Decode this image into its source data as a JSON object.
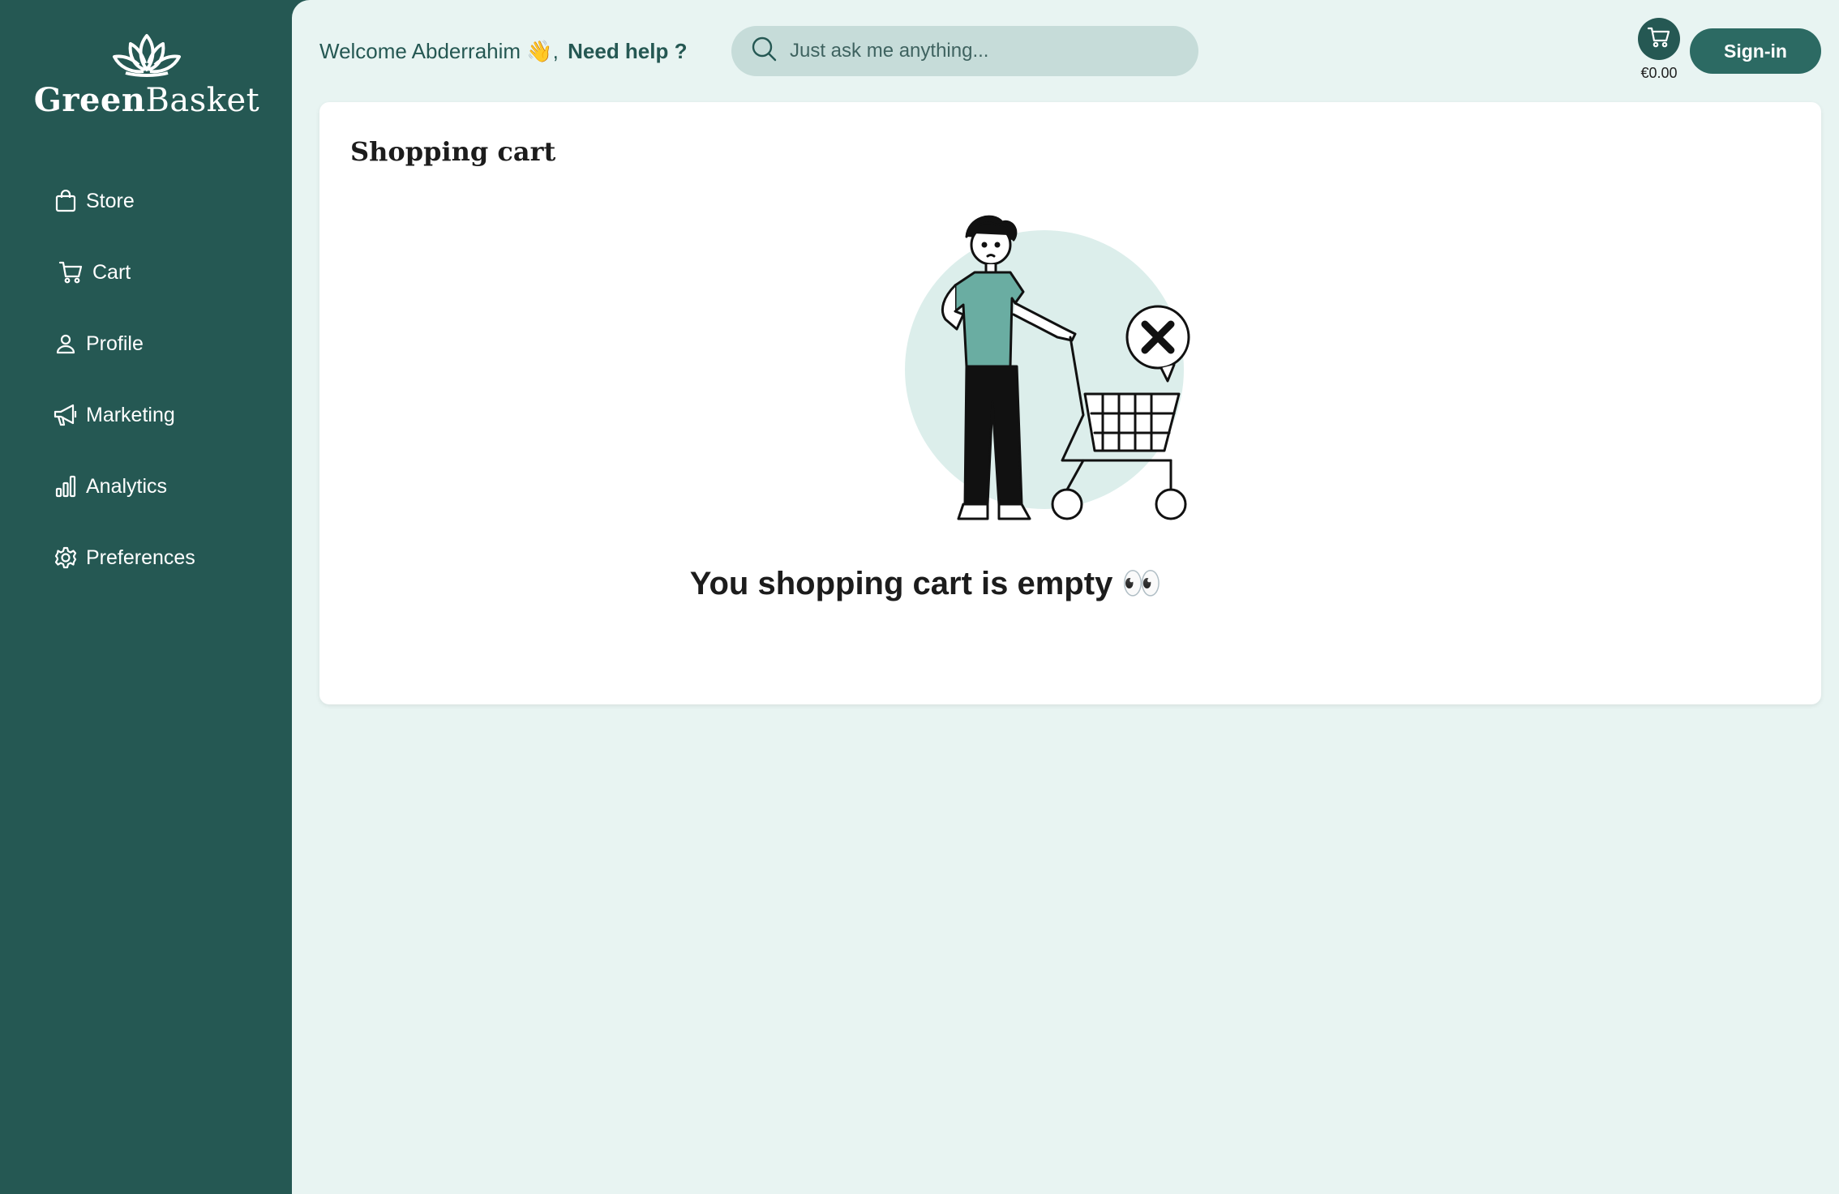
{
  "brand": {
    "name_bold": "Green",
    "name_light": "Basket"
  },
  "sidebar": {
    "items": [
      {
        "label": "Store",
        "icon": "shopping-bag-icon"
      },
      {
        "label": "Cart",
        "icon": "cart-icon"
      },
      {
        "label": "Profile",
        "icon": "user-icon"
      },
      {
        "label": "Marketing",
        "icon": "megaphone-icon"
      },
      {
        "label": "Analytics",
        "icon": "bar-chart-icon"
      },
      {
        "label": "Preferences",
        "icon": "gear-icon"
      }
    ]
  },
  "header": {
    "welcome": "Welcome Abderrahim 👋,",
    "help": "Need help ?",
    "search_placeholder": "Just ask me anything...",
    "cart_total": "€0.00",
    "signin_label": "Sign-in"
  },
  "cart_page": {
    "title": "Shopping cart",
    "empty_message": "You shopping cart is empty 👀"
  },
  "colors": {
    "sidebar": "#255853",
    "main_bg": "#e8f4f2",
    "accent": "#2c6a63",
    "search_bg": "#c6dcd9"
  }
}
